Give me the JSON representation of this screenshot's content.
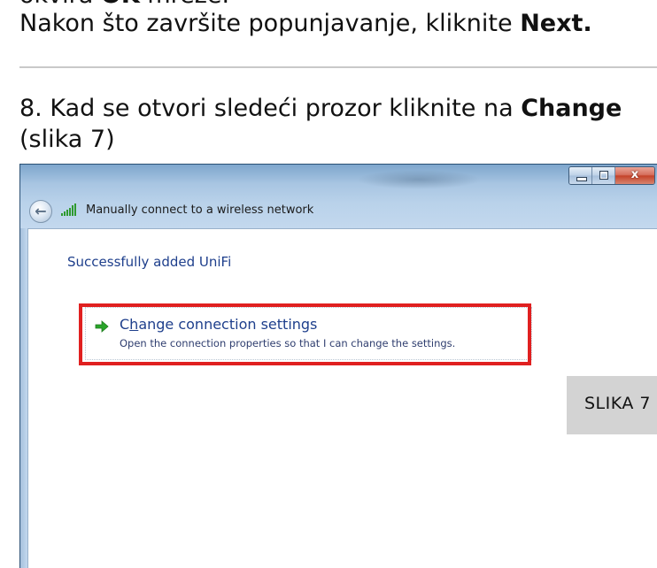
{
  "document": {
    "line_cut": {
      "prefix": "okvira",
      "bold": "OK",
      "suffix": " mreže."
    },
    "line_next": {
      "text": "Nakon što završite popunjavanje, kliknite ",
      "bold": "Next."
    },
    "step8": {
      "text": "8. Kad se otvori sledeći prozor kliknite na ",
      "bold": "Change"
    },
    "step8_cont": "(slika 7)",
    "figure_label": "SLIKA 7"
  },
  "dialog": {
    "window_title": "Manually connect to a wireless network",
    "heading": "Successfully added UniFi",
    "command_link": {
      "title_pre": "C",
      "title_underlined": "h",
      "title_post": "ange connection settings",
      "description": "Open the connection properties so that I can change the settings."
    },
    "caption_buttons": {
      "close_glyph": "x"
    }
  },
  "colors": {
    "highlight": "#e02020",
    "link_text": "#1e3f8c",
    "figure_label_bg": "#d3d3d3",
    "rule": "#c9c9c9"
  },
  "icons": [
    "back-arrow-icon",
    "wifi-signal-icon",
    "green-arrow-icon",
    "minimize-icon",
    "maximize-icon",
    "close-icon"
  ]
}
